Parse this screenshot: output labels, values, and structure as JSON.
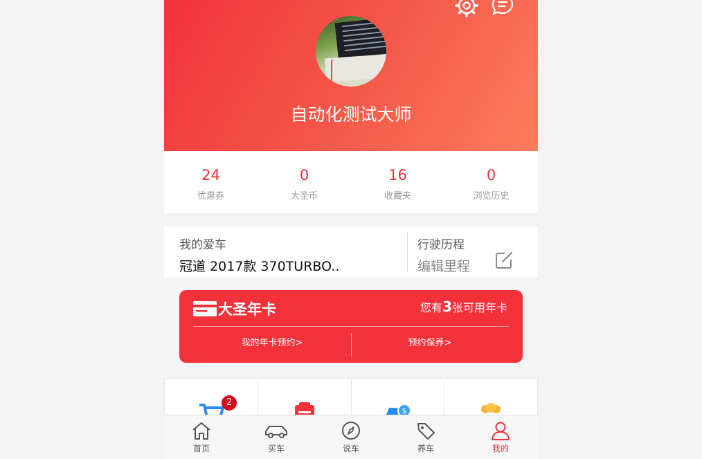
{
  "profile": {
    "username": "自动化测试大师"
  },
  "stats": [
    {
      "value": "24",
      "label": "优惠券"
    },
    {
      "value": "0",
      "label": "大圣币"
    },
    {
      "value": "16",
      "label": "收藏夹"
    },
    {
      "value": "0",
      "label": "浏览历史"
    }
  ],
  "my_car": {
    "title": "我的爱车",
    "model": "冠道 2017款 370TURBO..",
    "mileage_title": "行驶历程",
    "mileage_action": "编辑里程"
  },
  "annual_card": {
    "title": "大圣年卡",
    "info_prefix": "您有",
    "count": "3",
    "info_suffix": "张可用年卡",
    "link_reservation": "我的年卡预约>",
    "link_maintenance": "预约保养>"
  },
  "grid": {
    "cart_badge": "2"
  },
  "tabs": [
    {
      "label": "首页",
      "icon": "home-icon"
    },
    {
      "label": "买车",
      "icon": "car-icon"
    },
    {
      "label": "说车",
      "icon": "compass-icon"
    },
    {
      "label": "养车",
      "icon": "tag-icon"
    },
    {
      "label": "我的",
      "icon": "user-icon",
      "active": true
    }
  ],
  "colors": {
    "brand_red": "#f2313b",
    "accent_red": "#e8333b",
    "gradient_end": "#ff7c5e"
  }
}
